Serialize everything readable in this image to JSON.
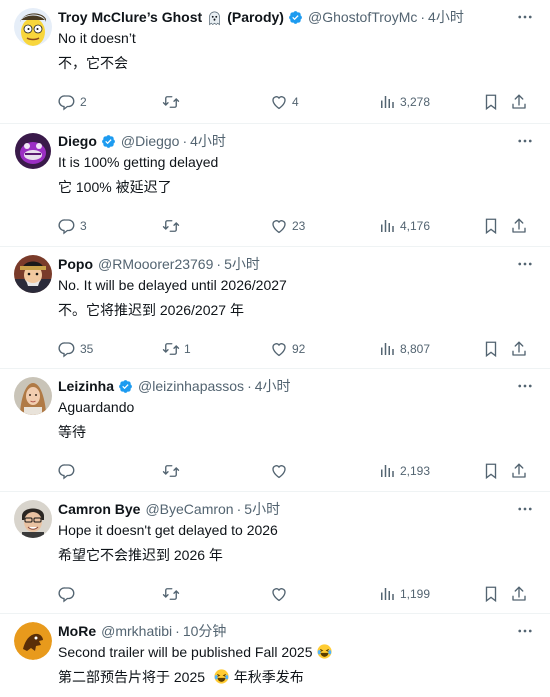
{
  "tweets": [
    {
      "name": "Troy McClure’s Ghost",
      "parody": "(Parody)",
      "handle": "@GhostofTroyMc",
      "time": "4小时",
      "line1": "No it doesn’t",
      "line2": "不，它不会",
      "replies": "2",
      "retweets": "",
      "likes": "4",
      "views": "3,278",
      "avatar": "simpsons-avatar"
    },
    {
      "name": "Diego",
      "handle": "@Dieggo",
      "time": "4小时",
      "line1": "It is 100% getting delayed",
      "line2": "它 100% 被延迟了",
      "replies": "3",
      "retweets": "",
      "likes": "23",
      "views": "4,176",
      "avatar": "purple-character-avatar"
    },
    {
      "name": "Popo",
      "handle": "@RMooorer23769",
      "time": "5小时",
      "line1": "No. It will be delayed until 2026/2027",
      "line2": "不。它将推迟到 2026/2027 年",
      "replies": "35",
      "retweets": "1",
      "likes": "92",
      "views": "8,807",
      "avatar": "anime-character-avatar"
    },
    {
      "name": "Leizinha",
      "handle": "@leizinhapassos",
      "time": "4小时",
      "line1": "Aguardando",
      "line2": "等待",
      "replies": "",
      "retweets": "",
      "likes": "",
      "views": "2,193",
      "avatar": "woman-photo-avatar"
    },
    {
      "name": "Camron Bye",
      "handle": "@ByeCamron",
      "time": "5小时",
      "line1": "Hope it doesn't get delayed to 2026",
      "line2": "希望它不会推迟到 2026 年",
      "replies": "",
      "retweets": "",
      "likes": "",
      "views": "1,199",
      "avatar": "man-photo-avatar"
    },
    {
      "name": "MoRe",
      "handle": "@mrkhatibi",
      "time": "10分钟",
      "line1": "Second trailer will be published Fall 2025",
      "line2a": "第二部预告片将于 2025",
      "line2b": "年秋季发布",
      "avatar": "orange-logo-avatar"
    }
  ],
  "colors": {
    "verified": "#1d9bf0",
    "muted": "#536471",
    "text": "#0f1419",
    "divider": "#eff3f4"
  },
  "icons": [
    "verified-badge-icon",
    "more-icon",
    "reply-icon",
    "retweet-icon",
    "like-icon",
    "views-icon",
    "bookmark-icon",
    "share-icon",
    "ghost-emoji-icon",
    "laughing-emoji-icon"
  ]
}
